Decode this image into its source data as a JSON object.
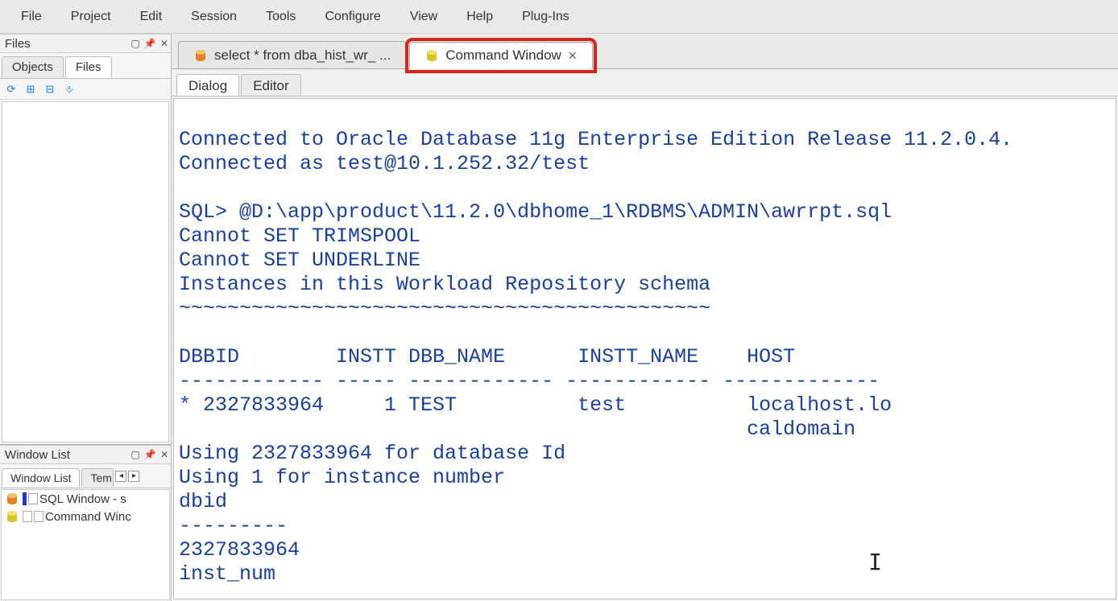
{
  "menubar": [
    "File",
    "Project",
    "Edit",
    "Session",
    "Tools",
    "Configure",
    "View",
    "Help",
    "Plug-Ins"
  ],
  "files_panel": {
    "title": "Files",
    "tabs": {
      "objects": "Objects",
      "files": "Files"
    }
  },
  "window_list_panel": {
    "title": "Window List",
    "tabs": {
      "list": "Window List",
      "templates": "Tem"
    },
    "items": [
      {
        "icon": "sql",
        "label": "SQL Window - s"
      },
      {
        "icon": "cmd",
        "label": "Command Winc"
      }
    ]
  },
  "doc_tabs": {
    "sql": "select * from dba_hist_wr_ ...",
    "cmd": "Command Window",
    "close": "✕"
  },
  "inner_tabs": {
    "dialog": "Dialog",
    "editor": "Editor"
  },
  "console_text": "Connected to Oracle Database 11g Enterprise Edition Release 11.2.0.4.\nConnected as test@10.1.252.32/test\n\nSQL> @D:\\app\\product\\11.2.0\\dbhome_1\\RDBMS\\ADMIN\\awrrpt.sql\nCannot SET TRIMSPOOL\nCannot SET UNDERLINE\nInstances in this Workload Repository schema\n~~~~~~~~~~~~~~~~~~~~~~~~~~~~~~~~~~~~~~~~~~~~\n\nDBBID        INSTT DBB_NAME      INSTT_NAME    HOST\n------------ ----- ------------ ------------ -------------\n* 2327833964     1 TEST          test          localhost.lo\n                                               caldomain\nUsing 2327833964 for database Id\nUsing 1 for instance number\ndbid\n---------\n2327833964\ninst_num"
}
